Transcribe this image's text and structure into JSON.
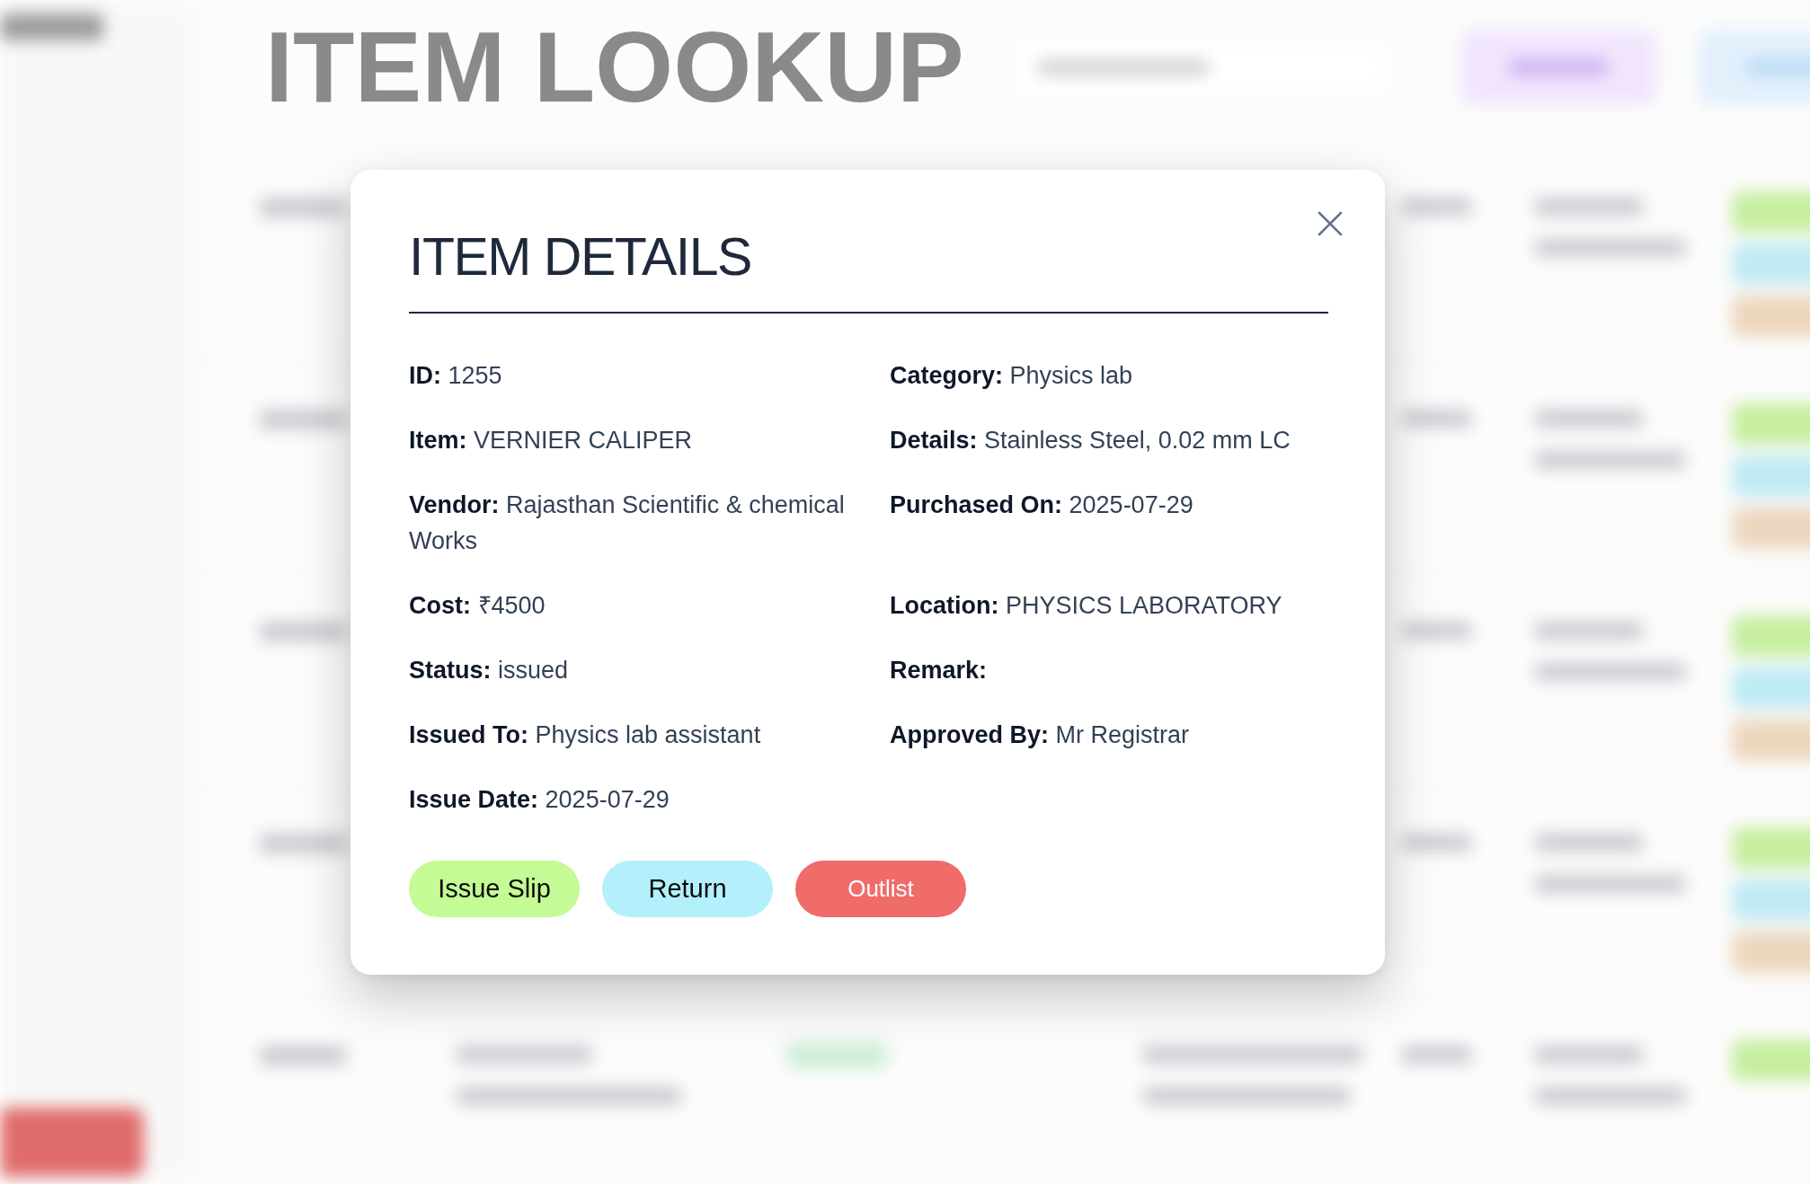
{
  "page": {
    "title": "ITEM LOOKUP"
  },
  "dialog": {
    "title": "ITEM DETAILS",
    "fields": [
      {
        "label": "ID:",
        "value": "1255"
      },
      {
        "label": "Category:",
        "value": "Physics lab"
      },
      {
        "label": "Item:",
        "value": "VERNIER CALIPER"
      },
      {
        "label": "Details:",
        "value": "Stainless Steel, 0.02 mm LC"
      },
      {
        "label": "Vendor:",
        "value": "Rajasthan Scientific & chemical Works"
      },
      {
        "label": "Purchased On:",
        "value": "2025-07-29"
      },
      {
        "label": "Cost:",
        "value": "₹4500"
      },
      {
        "label": "Location:",
        "value": "PHYSICS LABORATORY"
      },
      {
        "label": "Status:",
        "value": "issued"
      },
      {
        "label": "Remark:"
      },
      {
        "label": "Issued To:",
        "value": "Physics lab assistant"
      },
      {
        "label": "Approved By:",
        "value": "Mr Registrar"
      },
      {
        "label": "Issue Date:",
        "value": "2025-07-29"
      }
    ],
    "buttons": [
      {
        "label": "Issue Slip",
        "kind": "issue"
      },
      {
        "label": "Return",
        "kind": "return"
      },
      {
        "label": "Outlist",
        "kind": "outlist"
      }
    ]
  }
}
